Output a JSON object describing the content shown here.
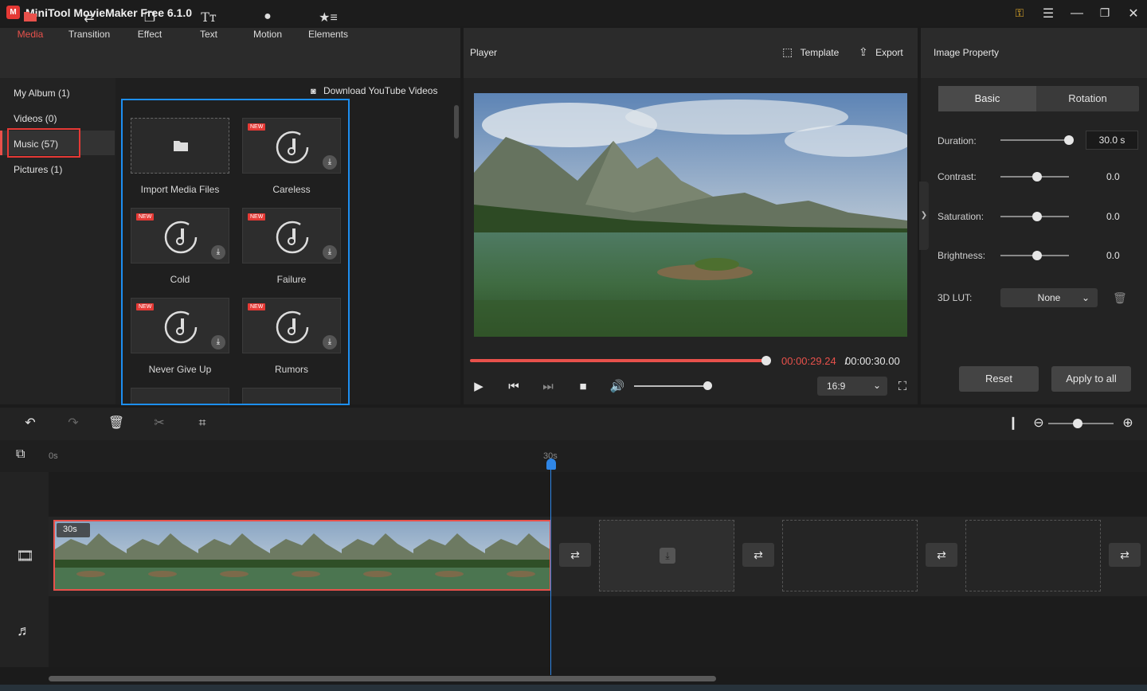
{
  "app": {
    "title": "MiniTool MovieMaker Free 6.1.0",
    "logo_text": "M"
  },
  "window": {
    "key_icon": "key-icon",
    "menu_icon": "hamburger-icon"
  },
  "tabs": [
    {
      "label": "Media",
      "icon": "media-icon",
      "active": true
    },
    {
      "label": "Transition",
      "icon": "transition-icon"
    },
    {
      "label": "Effect",
      "icon": "effect-icon"
    },
    {
      "label": "Text",
      "icon": "text-icon"
    },
    {
      "label": "Motion",
      "icon": "motion-icon"
    },
    {
      "label": "Elements",
      "icon": "elements-icon"
    }
  ],
  "sidebar": {
    "items": [
      {
        "label": "My Album (1)"
      },
      {
        "label": "Videos (0)"
      },
      {
        "label": "Music (57)",
        "selected": true
      },
      {
        "label": "Pictures (1)"
      }
    ]
  },
  "media": {
    "download_label": "Download YouTube Videos",
    "new_badge": "NEW",
    "tiles": [
      {
        "label": "Import Media Files",
        "type": "import"
      },
      {
        "label": "Careless",
        "type": "music",
        "new": true
      },
      {
        "label": "Cold",
        "type": "music",
        "new": true
      },
      {
        "label": "Failure",
        "type": "music",
        "new": true
      },
      {
        "label": "Never Give Up",
        "type": "music",
        "new": true
      },
      {
        "label": "Rumors",
        "type": "music",
        "new": true
      }
    ]
  },
  "player": {
    "title": "Player",
    "template_label": "Template",
    "export_label": "Export",
    "time_current": "00:00:29.24",
    "time_separator": " / ",
    "time_total": "00:00:30.00",
    "progress": 0.98,
    "volume": 0.92,
    "aspect": "16:9"
  },
  "property": {
    "title": "Image Property",
    "tab_basic": "Basic",
    "tab_rotation": "Rotation",
    "duration_label": "Duration:",
    "duration_value": "30.0 s",
    "contrast_label": "Contrast:",
    "contrast_value": "0.0",
    "saturation_label": "Saturation:",
    "saturation_value": "0.0",
    "brightness_label": "Brightness:",
    "brightness_value": "0.0",
    "lut_label": "3D LUT:",
    "lut_value": "None",
    "reset_label": "Reset",
    "apply_label": "Apply to all"
  },
  "timeline": {
    "ruler_start": "0s",
    "ruler_mark": "30s",
    "clip_duration": "30s",
    "zoom_level": 0.45
  },
  "colors": {
    "accent": "#e8514b",
    "highlight": "#1d8ff2",
    "playhead": "#2f86e6"
  }
}
